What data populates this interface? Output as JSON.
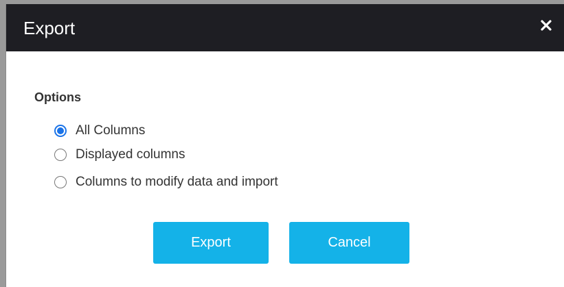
{
  "dialog": {
    "title": "Export",
    "close_icon": "close-icon"
  },
  "options": {
    "heading": "Options",
    "items": [
      {
        "label": "All Columns",
        "selected": true
      },
      {
        "label": "Displayed columns",
        "selected": false
      },
      {
        "label": "Columns to modify data and import",
        "selected": false
      }
    ]
  },
  "buttons": {
    "export_label": "Export",
    "cancel_label": "Cancel"
  },
  "colors": {
    "titlebar": "#1e1e23",
    "accent_button": "#14b2e8",
    "radio_selected": "#1a73e8"
  }
}
